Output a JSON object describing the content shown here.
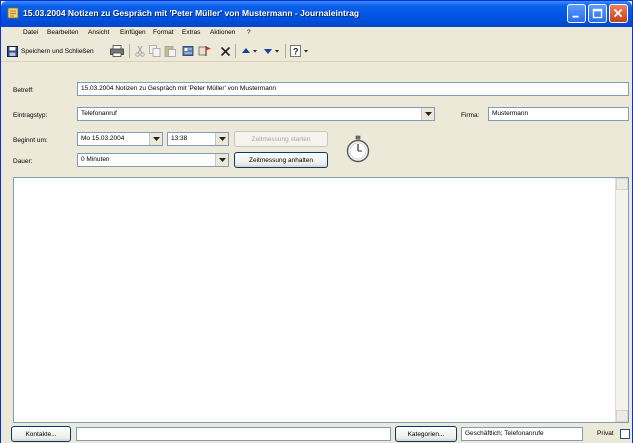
{
  "window": {
    "title": "15.03.2004 Notizen zu Gespräch mit 'Peter Müller' von Mustermann - Journaleintrag"
  },
  "menu": [
    "Datei",
    "Bearbeiten",
    "Ansicht",
    "Einfügen",
    "Format",
    "Extras",
    "Aktionen",
    "?"
  ],
  "toolbar": {
    "save_label": "Speichern und Schließen"
  },
  "form": {
    "subject_label": "Betreff:",
    "subject_value": "15.03.2004 Notizen zu Gespräch mit 'Peter Müller' von Mustermann",
    "type_label": "Eintragstyp:",
    "type_value": "Telefonanruf",
    "company_label": "Firma:",
    "company_value": "Mustermann",
    "start_label": "Beginnt um:",
    "start_date": "Mo 15.03.2004",
    "start_time": "13:38",
    "start_timer_button": "Zeitmessung starten",
    "duration_label": "Dauer:",
    "duration_value": "0 Minuten",
    "pause_timer_button": "Zeitmessung anhalten"
  },
  "footer": {
    "contacts_button": "Kontakte...",
    "contacts_value": "",
    "categories_button": "Kategorien...",
    "categories_value": "Geschäftlich; Telefonanrufe",
    "private_label": "Privat"
  }
}
